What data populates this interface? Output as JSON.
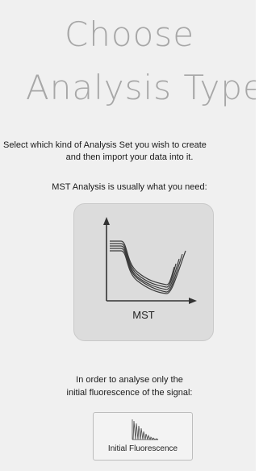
{
  "header": {
    "title_line1": "Choose",
    "title_line2": "Analysis Type"
  },
  "intro": {
    "line1": "Select which kind of Analysis Set you wish to create",
    "line2": "and then import your data into it.",
    "recommendation": "MST Analysis is usually what you need:"
  },
  "mst_option": {
    "label": "MST",
    "icon": "mst-curve-chart-icon"
  },
  "fluorescence_hint": {
    "line1": "In order to analyse only the",
    "line2": "initial fluorescence of the signal:"
  },
  "fluorescence_option": {
    "label": "Initial Fluorescence",
    "icon": "fluorescence-peaks-icon"
  },
  "colors": {
    "background": "#f0f0f0",
    "title": "#a7a7a7",
    "mst_button_bg": "#dcdcdc",
    "text": "#1a1a1a"
  }
}
